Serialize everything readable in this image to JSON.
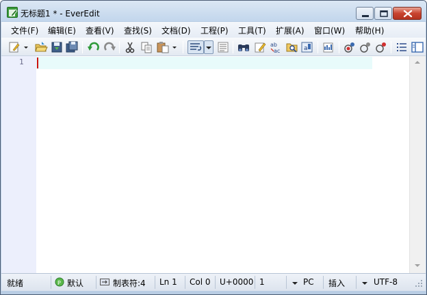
{
  "window": {
    "title": "无标题1 * - EverEdit",
    "controls": [
      "minimize",
      "maximize",
      "close"
    ]
  },
  "menu": [
    {
      "label": "文件(F)"
    },
    {
      "label": "编辑(E)"
    },
    {
      "label": "查看(V)"
    },
    {
      "label": "查找(S)"
    },
    {
      "label": "文档(D)"
    },
    {
      "label": "工程(P)"
    },
    {
      "label": "工具(T)"
    },
    {
      "label": "扩展(A)"
    },
    {
      "label": "窗口(W)"
    },
    {
      "label": "帮助(H)"
    }
  ],
  "toolbar": {
    "buttons": [
      "new-document-icon",
      "open-folder-icon",
      "save-icon",
      "save-all-icon",
      "undo-icon",
      "redo-icon",
      "cut-icon",
      "copy-icon",
      "paste-icon",
      "word-wrap-icon",
      "text-view-icon",
      "find-binoculars-icon",
      "find-edit-icon",
      "replace-abc-icon",
      "find-in-files-icon",
      "replace-in-files-icon",
      "macro-icon",
      "record-macro-icon",
      "play-macro-icon",
      "run-macro-icon",
      "list-icon",
      "panel-icon"
    ]
  },
  "editor": {
    "line_numbers": [
      "1"
    ],
    "content": ""
  },
  "status": {
    "state": "就绪",
    "scheme": "默认",
    "tab_label": "制表符:4",
    "line": "Ln 1",
    "column": "Col 0",
    "codepoint": "U+0000",
    "selection": "1",
    "line_ending": "PC",
    "insert_mode": "插入",
    "encoding": "UTF-8"
  },
  "colors": {
    "gutter_bg": "#eceffc",
    "current_line_bg": "#e8fbfb",
    "caret": "#cc1010",
    "title_bar": "#c2d6ec"
  }
}
